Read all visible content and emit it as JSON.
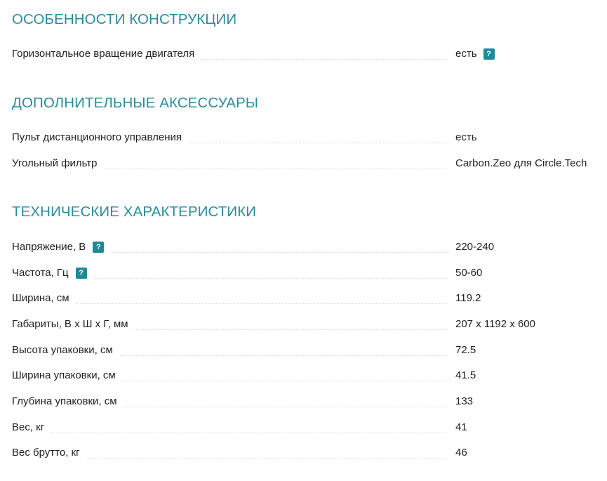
{
  "sections": [
    {
      "title": "ОСОБЕННОСТИ КОНСТРУКЦИИ",
      "rows": [
        {
          "label": "Горизонтальное вращение двигателя",
          "value": "есть",
          "value_help": "?"
        }
      ]
    },
    {
      "title": "ДОПОЛНИТЕЛЬНЫЕ АКСЕССУАРЫ",
      "rows": [
        {
          "label": "Пульт дистанционного управления",
          "value": "есть"
        },
        {
          "label": "Угольный фильтр",
          "value": "Carbon.Zeo для Circle.Tech"
        }
      ]
    },
    {
      "title": "ТЕХНИЧЕСКИЕ ХАРАКТЕРИСТИКИ",
      "rows": [
        {
          "label": "Напряжение, В",
          "label_help": "?",
          "value": "220-240"
        },
        {
          "label": "Частота, Гц",
          "label_help": "?",
          "value": "50-60"
        },
        {
          "label": "Ширина, см",
          "value": "119.2"
        },
        {
          "label": "Габариты, В х Ш х Г, мм",
          "value": "207 x 1192 x 600"
        },
        {
          "label": "Высота упаковки, см",
          "value": "72.5"
        },
        {
          "label": "Ширина упаковки, см",
          "value": "41.5"
        },
        {
          "label": "Глубина упаковки, см",
          "value": "133"
        },
        {
          "label": "Вес, кг",
          "value": "41"
        },
        {
          "label": "Вес брутто, кг",
          "value": "46"
        }
      ]
    }
  ],
  "colors": {
    "heading": "#2a8c9c",
    "help_badge": "#1e8a97",
    "text": "#222222",
    "leader_dots": "#cfdde0"
  },
  "icons": {
    "help": "question-mark-badge-icon"
  }
}
